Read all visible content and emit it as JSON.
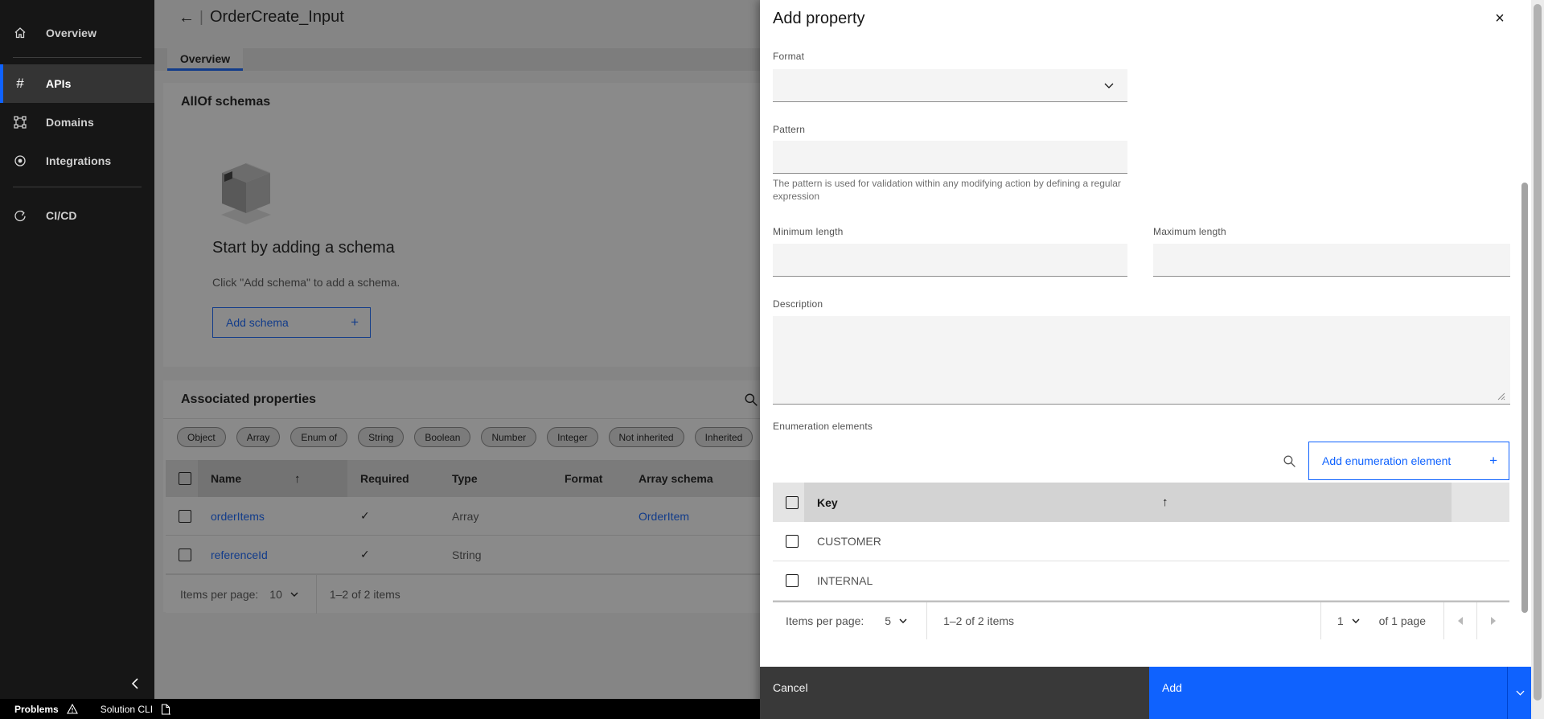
{
  "icons": {
    "back": "←",
    "pipe": "|",
    "sort_asc": "↑",
    "close": "×",
    "plus": "+",
    "check": "✓"
  },
  "sidebar": {
    "items": [
      {
        "label": "Overview"
      },
      {
        "label": "APIs"
      },
      {
        "label": "Domains"
      },
      {
        "label": "Integrations"
      },
      {
        "label": "CI/CD"
      }
    ]
  },
  "header": {
    "title": "OrderCreate_Input",
    "tab": "Overview"
  },
  "allof": {
    "heading": "AllOf schemas",
    "empty_title": "Start by adding a schema",
    "empty_subtitle": "Click \"Add schema\" to add a schema.",
    "add_button": "Add schema"
  },
  "assoc": {
    "heading": "Associated properties",
    "tags": [
      "Object",
      "Array",
      "Enum of",
      "String",
      "Boolean",
      "Number",
      "Integer",
      "Not inherited",
      "Inherited"
    ],
    "columns": {
      "name": "Name",
      "required": "Required",
      "type": "Type",
      "format": "Format",
      "array_schema": "Array schema"
    },
    "rows": [
      {
        "name": "orderItems",
        "type": "Array",
        "format": "",
        "array_schema": "OrderItem"
      },
      {
        "name": "referenceId",
        "type": "String",
        "format": "",
        "array_schema": ""
      }
    ],
    "pagination": {
      "items_per_page_label": "Items per page:",
      "page_size": "10",
      "range": "1–2 of 2 items"
    }
  },
  "statusbar": {
    "problems": "Problems",
    "solution_cli": "Solution CLI"
  },
  "modal": {
    "title": "Add property",
    "format_label": "Format",
    "pattern_label": "Pattern",
    "pattern_helper": "The pattern is used for validation within any modifying action by defining a regular expression",
    "min_label": "Minimum length",
    "max_label": "Maximum length",
    "description_label": "Description",
    "enum": {
      "label": "Enumeration elements",
      "add_button": "Add enumeration element",
      "key_header": "Key",
      "rows": [
        "CUSTOMER",
        "INTERNAL"
      ],
      "pagination": {
        "items_per_page_label": "Items per page:",
        "page_size": "5",
        "range": "1–2 of 2 items",
        "page": "1",
        "of_pages": "of 1 page"
      }
    },
    "footer": {
      "cancel": "Cancel",
      "add": "Add"
    }
  },
  "colors": {
    "accent": "#0f62fe",
    "sidebar_bg": "#161616",
    "cancel_bg": "#393939"
  }
}
